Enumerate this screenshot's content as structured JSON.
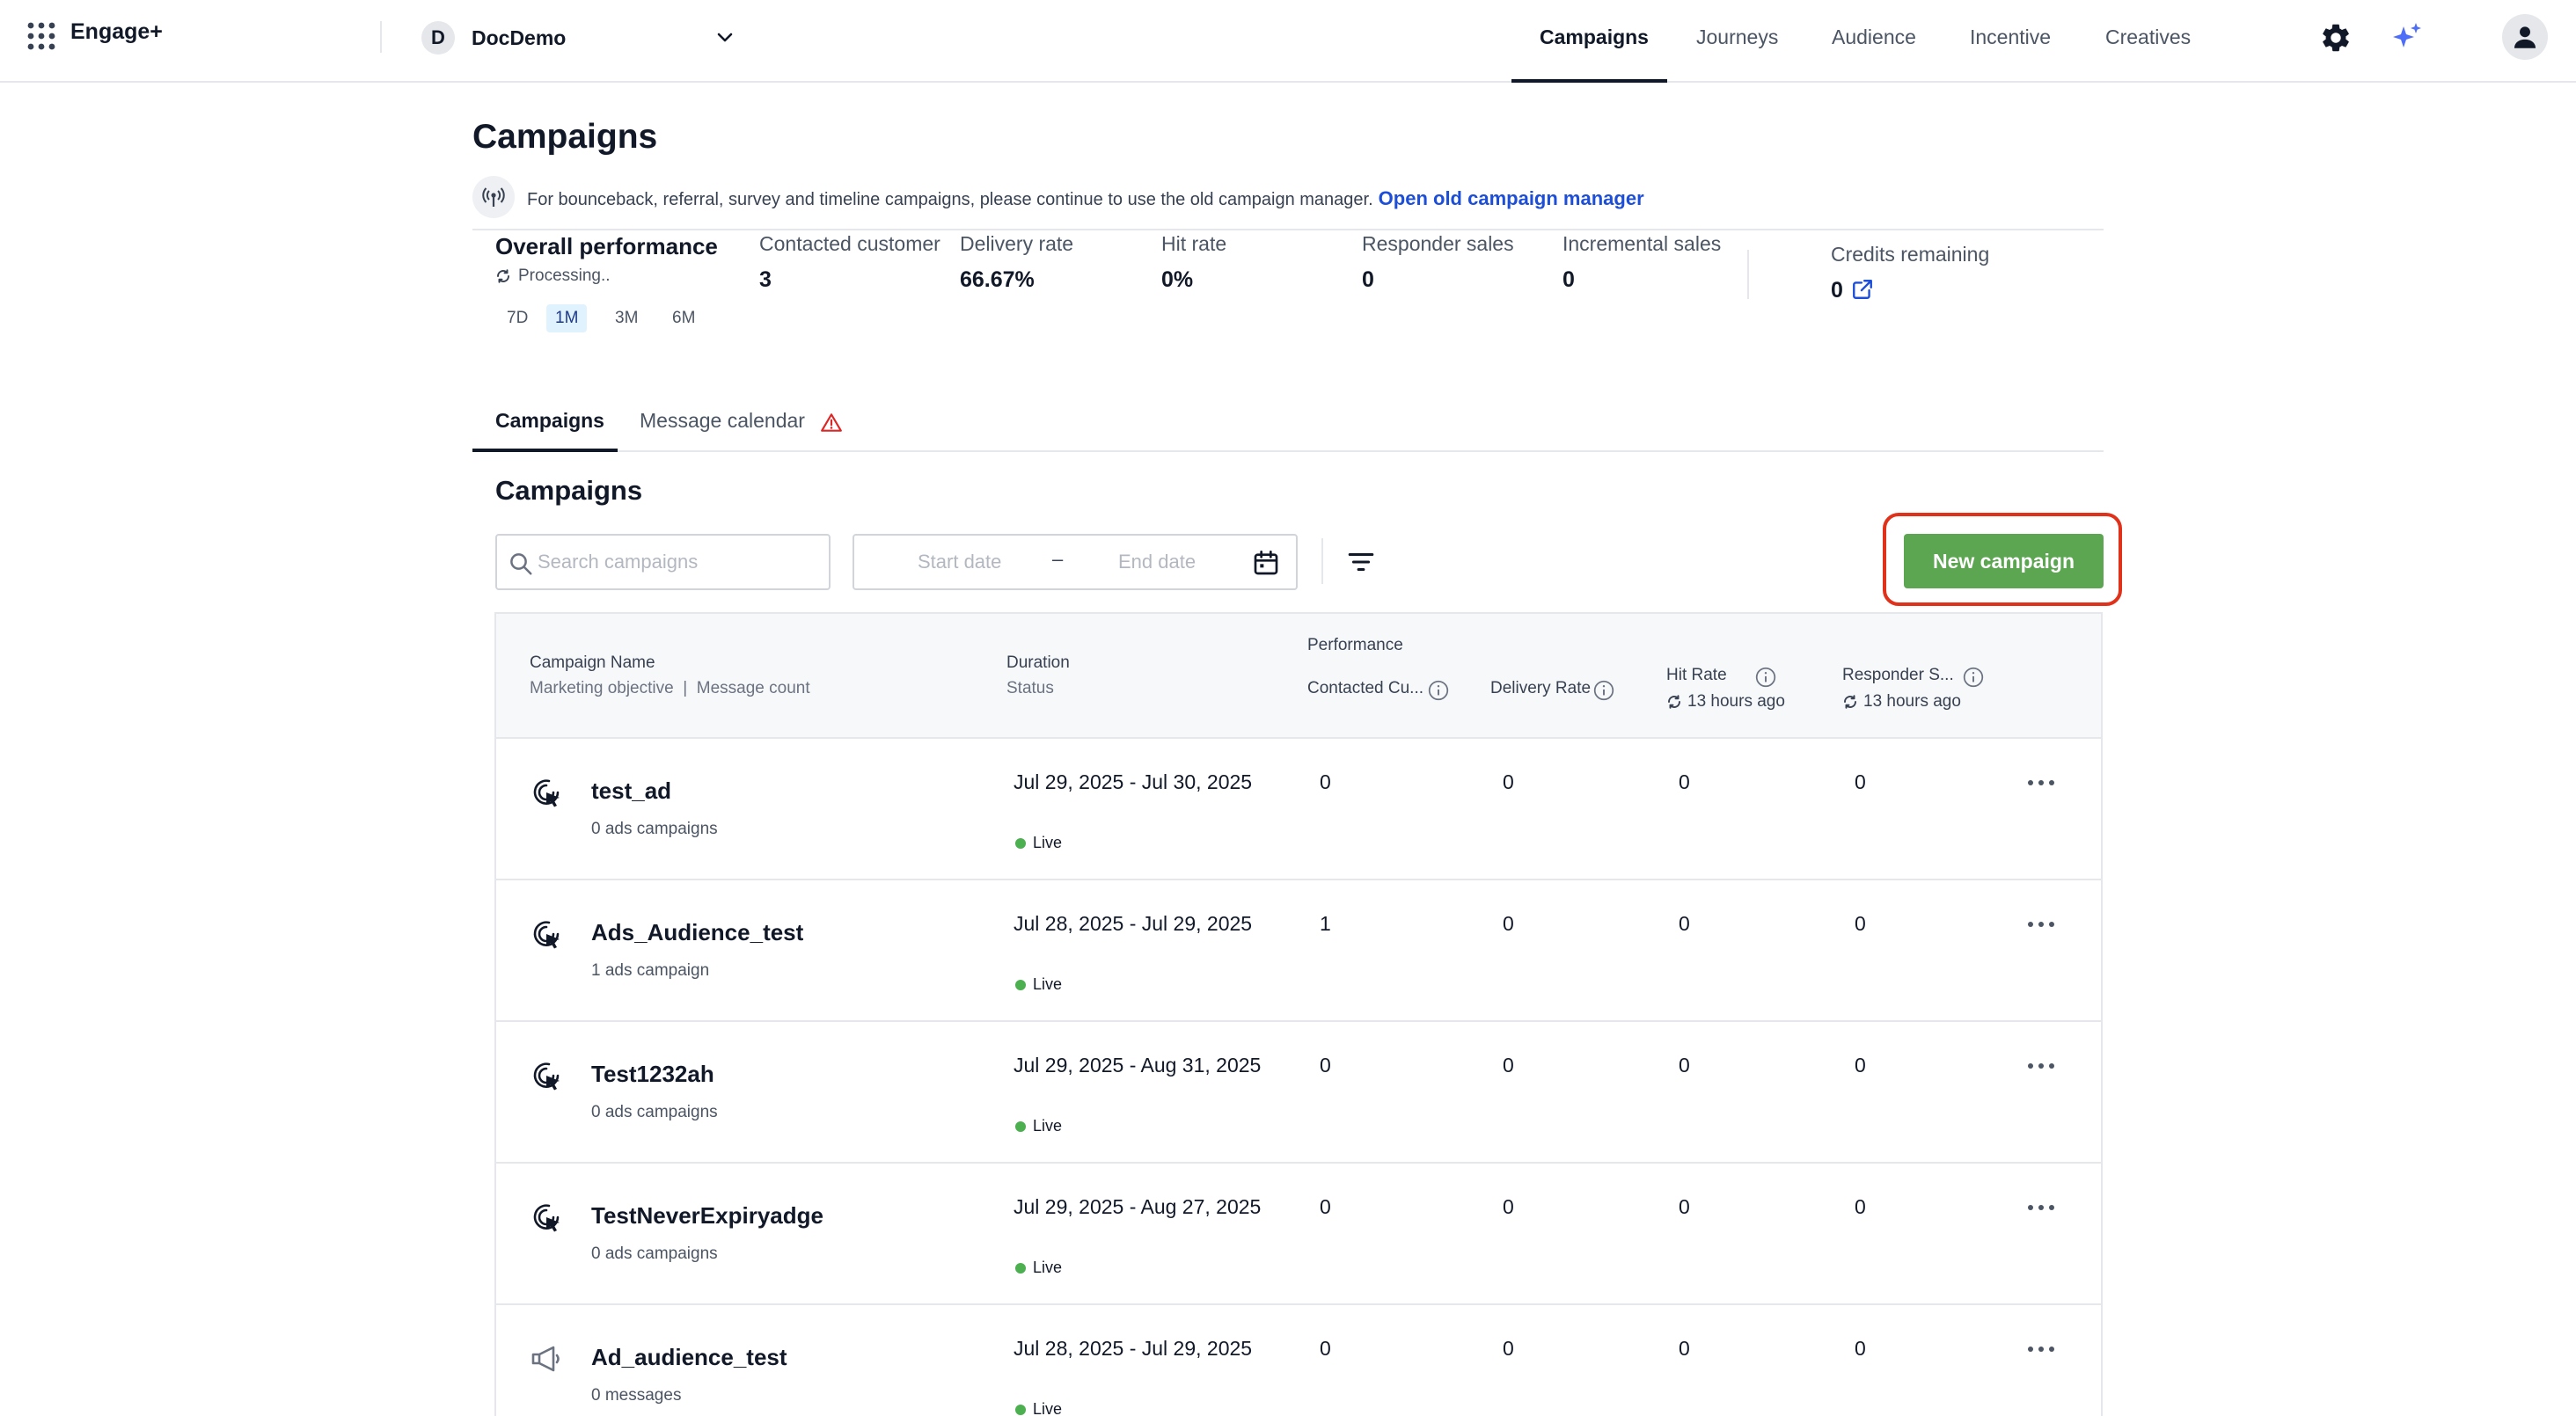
{
  "app": {
    "name": "Engage+"
  },
  "workspace": {
    "initial": "D",
    "name": "DocDemo"
  },
  "nav": {
    "tabs": [
      "Campaigns",
      "Journeys",
      "Audience",
      "Incentive",
      "Creatives"
    ],
    "active": "Campaigns"
  },
  "page": {
    "title": "Campaigns",
    "info_text": "For bounceback, referral, survey and timeline campaigns, please continue to use the old campaign manager.",
    "info_link": "Open old campaign manager"
  },
  "performance": {
    "title": "Overall performance",
    "status": "Processing..",
    "periods": [
      "7D",
      "1M",
      "3M",
      "6M"
    ],
    "active_period": "1M",
    "metrics": [
      {
        "label": "Contacted customer",
        "value": "3"
      },
      {
        "label": "Delivery rate",
        "value": "66.67%"
      },
      {
        "label": "Hit rate",
        "value": "0%"
      },
      {
        "label": "Responder sales",
        "value": "0"
      },
      {
        "label": "Incremental sales",
        "value": "0"
      }
    ],
    "credits_label": "Credits remaining",
    "credits_value": "0"
  },
  "subtabs": [
    "Campaigns",
    "Message calendar"
  ],
  "section_title": "Campaigns",
  "toolbar": {
    "search_placeholder": "Search campaigns",
    "start_date_placeholder": "Start date",
    "date_separator": "–",
    "end_date_placeholder": "End date",
    "new_campaign_label": "New campaign"
  },
  "table": {
    "headers": {
      "name": "Campaign Name",
      "objective": "Marketing objective",
      "separator": "|",
      "message_count": "Message count",
      "duration": "Duration",
      "status": "Status",
      "performance": "Performance",
      "contacted": "Contacted Cu...",
      "delivery": "Delivery Rate",
      "hit_rate": "Hit Rate",
      "hit_rate_updated": "13 hours ago",
      "responder": "Responder S...",
      "responder_updated": "13 hours ago"
    },
    "rows": [
      {
        "icon": "ads-cursor-icon",
        "name": "test_ad",
        "count": "0 ads campaigns",
        "duration": "Jul 29, 2025 - Jul 30, 2025",
        "status": "Live",
        "contacted": "0",
        "delivery": "0",
        "hit": "0",
        "responder": "0"
      },
      {
        "icon": "ads-cursor-icon",
        "name": "Ads_Audience_test",
        "count": "1 ads campaign",
        "duration": "Jul 28, 2025 - Jul 29, 2025",
        "status": "Live",
        "contacted": "1",
        "delivery": "0",
        "hit": "0",
        "responder": "0"
      },
      {
        "icon": "ads-cursor-icon",
        "name": "Test1232ah",
        "count": "0 ads campaigns",
        "duration": "Jul 29, 2025 - Aug 31, 2025",
        "status": "Live",
        "contacted": "0",
        "delivery": "0",
        "hit": "0",
        "responder": "0"
      },
      {
        "icon": "ads-cursor-icon",
        "name": "TestNeverExpiryadge",
        "count": "0 ads campaigns",
        "duration": "Jul 29, 2025 - Aug 27, 2025",
        "status": "Live",
        "contacted": "0",
        "delivery": "0",
        "hit": "0",
        "responder": "0"
      },
      {
        "icon": "megaphone-icon",
        "name": "Ad_audience_test",
        "count": "0 messages",
        "duration": "Jul 28, 2025 - Jul 29, 2025",
        "status": "Live",
        "contacted": "0",
        "delivery": "0",
        "hit": "0",
        "responder": "0"
      }
    ]
  },
  "colors": {
    "primary_button": "#5ca651",
    "highlight_outline": "#e0311b",
    "link": "#1d4ed8",
    "live_dot": "#4caf50",
    "sparkle": "#4f6ef7",
    "warning": "#dc2626"
  }
}
